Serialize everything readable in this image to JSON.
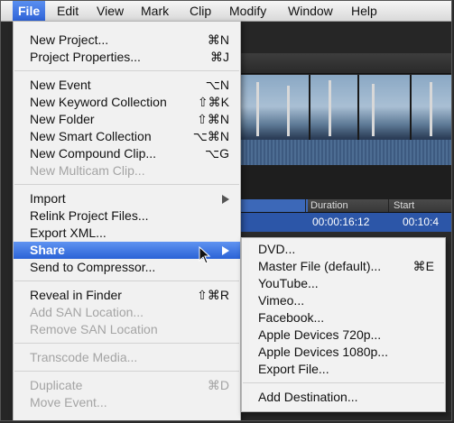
{
  "menubar": {
    "items": [
      "File",
      "Edit",
      "View",
      "Mark",
      "Clip",
      "Modify",
      "Window",
      "Help"
    ],
    "active": "File"
  },
  "file_menu": {
    "items": [
      {
        "label": "New Project...",
        "shortcut": "⌘N",
        "enabled": true
      },
      {
        "label": "Project Properties...",
        "shortcut": "⌘J",
        "enabled": true
      },
      {
        "label": "New Event",
        "shortcut": "⌥N",
        "enabled": true
      },
      {
        "label": "New Keyword Collection",
        "shortcut": "⇧⌘K",
        "enabled": true
      },
      {
        "label": "New Folder",
        "shortcut": "⇧⌘N",
        "enabled": true
      },
      {
        "label": "New Smart Collection",
        "shortcut": "⌥⌘N",
        "enabled": true
      },
      {
        "label": "New Compound Clip...",
        "shortcut": "⌥G",
        "enabled": true
      },
      {
        "label": "New Multicam Clip...",
        "shortcut": "",
        "enabled": false
      },
      {
        "label": "Import",
        "shortcut": "",
        "enabled": true,
        "submenu": true
      },
      {
        "label": "Relink Project Files...",
        "shortcut": "",
        "enabled": true
      },
      {
        "label": "Export XML...",
        "shortcut": "",
        "enabled": true
      },
      {
        "label": "Share",
        "shortcut": "",
        "enabled": true,
        "submenu": true,
        "highlighted": true
      },
      {
        "label": "Send to Compressor...",
        "shortcut": "",
        "enabled": true
      },
      {
        "label": "Reveal in Finder",
        "shortcut": "⇧⌘R",
        "enabled": true
      },
      {
        "label": "Add SAN Location...",
        "shortcut": "",
        "enabled": false
      },
      {
        "label": "Remove SAN Location",
        "shortcut": "",
        "enabled": false
      },
      {
        "label": "Transcode Media...",
        "shortcut": "",
        "enabled": false
      },
      {
        "label": "Duplicate",
        "shortcut": "⌘D",
        "enabled": false
      },
      {
        "label": "Move Event...",
        "shortcut": "",
        "enabled": false
      }
    ]
  },
  "share_submenu": {
    "items": [
      {
        "label": "DVD...",
        "shortcut": ""
      },
      {
        "label": "Master File (default)...",
        "shortcut": "⌘E"
      },
      {
        "label": "YouTube...",
        "shortcut": ""
      },
      {
        "label": "Vimeo...",
        "shortcut": ""
      },
      {
        "label": "Facebook...",
        "shortcut": ""
      },
      {
        "label": "Apple Devices 720p...",
        "shortcut": ""
      },
      {
        "label": "Apple Devices 1080p...",
        "shortcut": ""
      },
      {
        "label": "Export File...",
        "shortcut": ""
      },
      {
        "label": "Add Destination...",
        "shortcut": ""
      }
    ]
  },
  "background": {
    "columns": [
      "Duration",
      "Start"
    ],
    "selected_row": {
      "duration": "00:00:16:12",
      "start": "00:10:4"
    }
  },
  "colors": {
    "highlight": "#2a62d6",
    "menu_bg": "#f6f6f6",
    "disabled_text": "#a4a4a4"
  }
}
